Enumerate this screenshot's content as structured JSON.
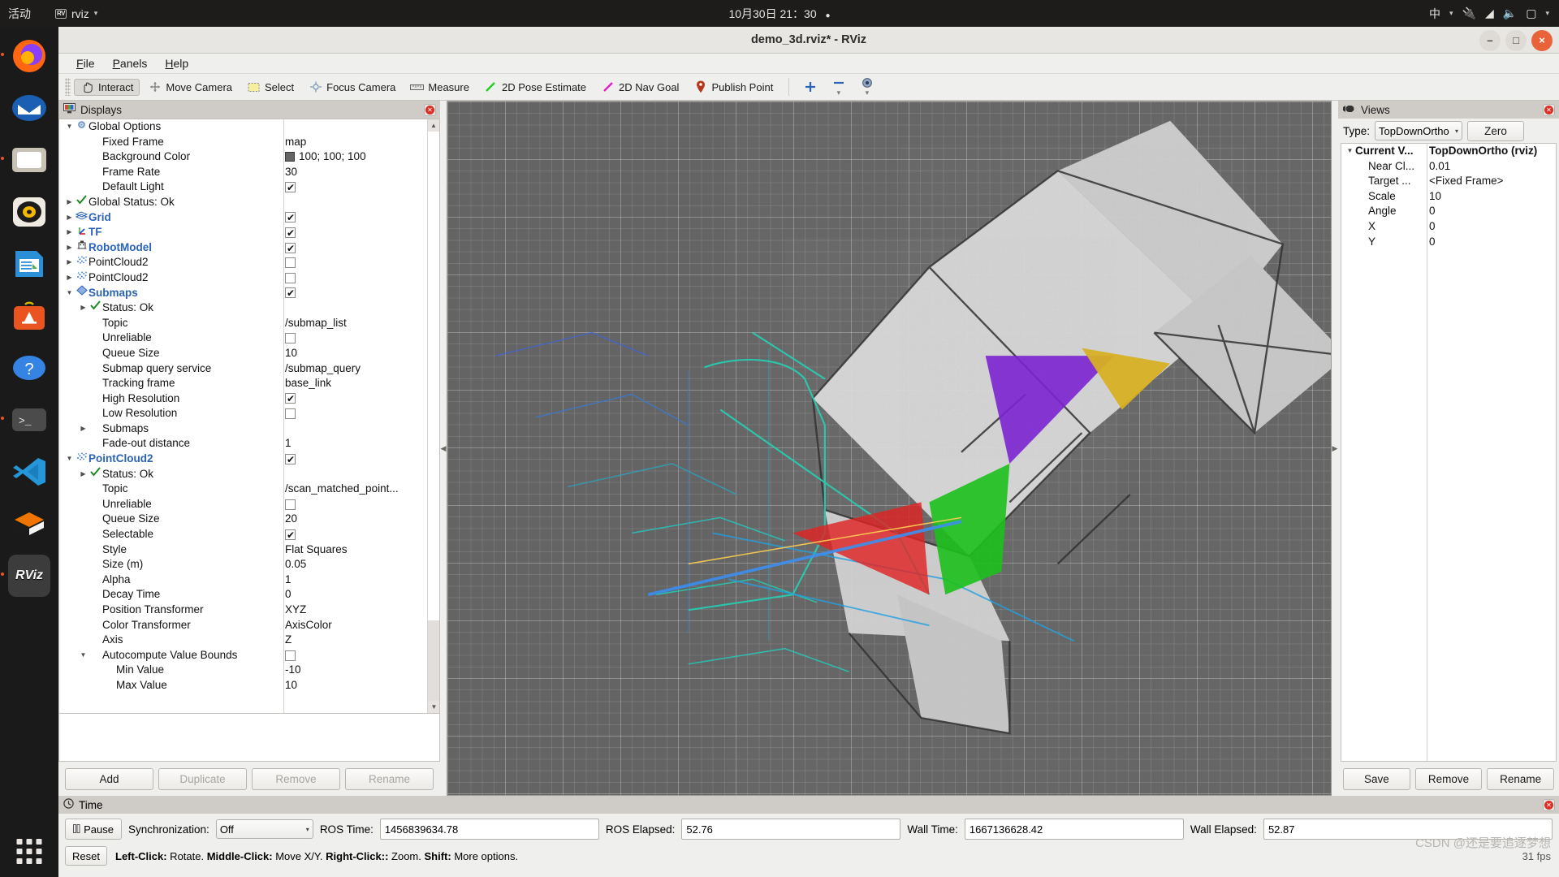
{
  "desktop": {
    "activities": "活动",
    "app_name": "rviz",
    "clock": "10月30日 21：30",
    "input_method": "中",
    "dock_items": [
      {
        "name": "firefox",
        "running": true
      },
      {
        "name": "thunderbird",
        "running": false
      },
      {
        "name": "files",
        "running": true
      },
      {
        "name": "rhythmbox",
        "running": false
      },
      {
        "name": "libreoffice-writer",
        "running": false
      },
      {
        "name": "ubuntu-software",
        "running": false
      },
      {
        "name": "help",
        "running": false
      },
      {
        "name": "terminal",
        "running": true
      },
      {
        "name": "vscode",
        "running": false
      },
      {
        "name": "cloudcompare",
        "running": false
      },
      {
        "name": "rviz",
        "running": true,
        "label": "RViz",
        "active": true
      }
    ]
  },
  "window": {
    "title": "demo_3d.rviz* - RViz",
    "minimize": "–",
    "maximize": "□",
    "close": "×"
  },
  "menubar": {
    "items": [
      {
        "first": "F",
        "rest": "ile"
      },
      {
        "first": "P",
        "rest": "anels"
      },
      {
        "first": "H",
        "rest": "elp"
      }
    ]
  },
  "toolbar": {
    "buttons": [
      {
        "label": "Interact",
        "icon": "hand-icon",
        "active": true
      },
      {
        "label": "Move Camera",
        "icon": "move-camera-icon",
        "active": false
      },
      {
        "label": "Select",
        "icon": "select-icon",
        "active": false
      },
      {
        "label": "Focus Camera",
        "icon": "focus-camera-icon",
        "active": false
      },
      {
        "label": "Measure",
        "icon": "measure-icon",
        "active": false
      },
      {
        "label": "2D Pose Estimate",
        "icon": "pose-estimate-icon",
        "active": false
      },
      {
        "label": "2D Nav Goal",
        "icon": "nav-goal-icon",
        "active": false
      },
      {
        "label": "Publish Point",
        "icon": "publish-point-icon",
        "active": false
      }
    ],
    "extras": [
      {
        "icon": "plus-icon",
        "name": "add-tool-button"
      },
      {
        "icon": "minus-icon",
        "name": "remove-tool-button"
      },
      {
        "icon": "circle-icon",
        "name": "tool-properties-button"
      }
    ]
  },
  "displays": {
    "panel_title": "Displays",
    "rows": [
      {
        "indent": 0,
        "arrow": "down",
        "icon": "gear-icon",
        "label": "Global Options",
        "value_type": "none",
        "bold": false
      },
      {
        "indent": 1,
        "arrow": "none",
        "icon": "none",
        "label": "Fixed Frame",
        "value_type": "text",
        "value": "map"
      },
      {
        "indent": 1,
        "arrow": "none",
        "icon": "none",
        "label": "Background Color",
        "value_type": "color",
        "value": "100; 100; 100",
        "color": "#646464"
      },
      {
        "indent": 1,
        "arrow": "none",
        "icon": "none",
        "label": "Frame Rate",
        "value_type": "text",
        "value": "30"
      },
      {
        "indent": 1,
        "arrow": "none",
        "icon": "none",
        "label": "Default Light",
        "value_type": "check",
        "checked": true
      },
      {
        "indent": 0,
        "arrow": "right",
        "icon": "check-icon",
        "label": "Global Status: Ok",
        "value_type": "none"
      },
      {
        "indent": 0,
        "arrow": "right",
        "icon": "grid-icon",
        "label": "Grid",
        "value_type": "check",
        "checked": true,
        "bold": true
      },
      {
        "indent": 0,
        "arrow": "right",
        "icon": "tf-icon",
        "label": "TF",
        "value_type": "check",
        "checked": true,
        "bold": true
      },
      {
        "indent": 0,
        "arrow": "right",
        "icon": "robot-icon",
        "label": "RobotModel",
        "value_type": "check",
        "checked": true,
        "bold": true
      },
      {
        "indent": 0,
        "arrow": "right",
        "icon": "pointcloud-icon",
        "label": "PointCloud2",
        "value_type": "check",
        "checked": false
      },
      {
        "indent": 0,
        "arrow": "right",
        "icon": "pointcloud-icon",
        "label": "PointCloud2",
        "value_type": "check",
        "checked": false
      },
      {
        "indent": 0,
        "arrow": "down",
        "icon": "submaps-icon",
        "label": "Submaps",
        "value_type": "check",
        "checked": true,
        "bold": true
      },
      {
        "indent": 1,
        "arrow": "right",
        "icon": "check-icon",
        "label": "Status: Ok",
        "value_type": "none"
      },
      {
        "indent": 1,
        "arrow": "none",
        "icon": "none",
        "label": "Topic",
        "value_type": "text",
        "value": "/submap_list"
      },
      {
        "indent": 1,
        "arrow": "none",
        "icon": "none",
        "label": "Unreliable",
        "value_type": "check",
        "checked": false
      },
      {
        "indent": 1,
        "arrow": "none",
        "icon": "none",
        "label": "Queue Size",
        "value_type": "text",
        "value": "10"
      },
      {
        "indent": 1,
        "arrow": "none",
        "icon": "none",
        "label": "Submap query service",
        "value_type": "text",
        "value": "/submap_query"
      },
      {
        "indent": 1,
        "arrow": "none",
        "icon": "none",
        "label": "Tracking frame",
        "value_type": "text",
        "value": "base_link"
      },
      {
        "indent": 1,
        "arrow": "none",
        "icon": "none",
        "label": "High Resolution",
        "value_type": "check",
        "checked": true
      },
      {
        "indent": 1,
        "arrow": "none",
        "icon": "none",
        "label": "Low Resolution",
        "value_type": "check",
        "checked": false
      },
      {
        "indent": 1,
        "arrow": "right",
        "icon": "none",
        "label": "Submaps",
        "value_type": "none"
      },
      {
        "indent": 1,
        "arrow": "none",
        "icon": "none",
        "label": "Fade-out distance",
        "value_type": "text",
        "value": "1"
      },
      {
        "indent": 0,
        "arrow": "down",
        "icon": "pointcloud-icon",
        "label": "PointCloud2",
        "value_type": "check",
        "checked": true,
        "bold": true
      },
      {
        "indent": 1,
        "arrow": "right",
        "icon": "check-icon",
        "label": "Status: Ok",
        "value_type": "none"
      },
      {
        "indent": 1,
        "arrow": "none",
        "icon": "none",
        "label": "Topic",
        "value_type": "text",
        "value": "/scan_matched_point..."
      },
      {
        "indent": 1,
        "arrow": "none",
        "icon": "none",
        "label": "Unreliable",
        "value_type": "check",
        "checked": false
      },
      {
        "indent": 1,
        "arrow": "none",
        "icon": "none",
        "label": "Queue Size",
        "value_type": "text",
        "value": "20"
      },
      {
        "indent": 1,
        "arrow": "none",
        "icon": "none",
        "label": "Selectable",
        "value_type": "check",
        "checked": true
      },
      {
        "indent": 1,
        "arrow": "none",
        "icon": "none",
        "label": "Style",
        "value_type": "text",
        "value": "Flat Squares"
      },
      {
        "indent": 1,
        "arrow": "none",
        "icon": "none",
        "label": "Size (m)",
        "value_type": "text",
        "value": "0.05"
      },
      {
        "indent": 1,
        "arrow": "none",
        "icon": "none",
        "label": "Alpha",
        "value_type": "text",
        "value": "1"
      },
      {
        "indent": 1,
        "arrow": "none",
        "icon": "none",
        "label": "Decay Time",
        "value_type": "text",
        "value": "0"
      },
      {
        "indent": 1,
        "arrow": "none",
        "icon": "none",
        "label": "Position Transformer",
        "value_type": "text",
        "value": "XYZ"
      },
      {
        "indent": 1,
        "arrow": "none",
        "icon": "none",
        "label": "Color Transformer",
        "value_type": "text",
        "value": "AxisColor"
      },
      {
        "indent": 1,
        "arrow": "none",
        "icon": "none",
        "label": "Axis",
        "value_type": "text",
        "value": "Z"
      },
      {
        "indent": 1,
        "arrow": "down",
        "icon": "none",
        "label": "Autocompute Value Bounds",
        "value_type": "check",
        "checked": false
      },
      {
        "indent": 2,
        "arrow": "none",
        "icon": "none",
        "label": "Min Value",
        "value_type": "text",
        "value": "-10"
      },
      {
        "indent": 2,
        "arrow": "none",
        "icon": "none",
        "label": "Max Value",
        "value_type": "text",
        "value": "10"
      }
    ],
    "buttons": [
      {
        "label": "Add",
        "enabled": true
      },
      {
        "label": "Duplicate",
        "enabled": false
      },
      {
        "label": "Remove",
        "enabled": false
      },
      {
        "label": "Rename",
        "enabled": false
      }
    ]
  },
  "views": {
    "panel_title": "Views",
    "type_label": "Type:",
    "type_value": "TopDownOrtho (",
    "zero_button": "Zero",
    "rows": [
      {
        "indent": 0,
        "arrow": "down",
        "label": "Current V...",
        "value": "TopDownOrtho (rviz)",
        "bold": true
      },
      {
        "indent": 1,
        "arrow": "none",
        "label": "Near Cl...",
        "value": "0.01"
      },
      {
        "indent": 1,
        "arrow": "none",
        "label": "Target ...",
        "value": "<Fixed Frame>"
      },
      {
        "indent": 1,
        "arrow": "none",
        "label": "Scale",
        "value": "10"
      },
      {
        "indent": 1,
        "arrow": "none",
        "label": "Angle",
        "value": "0"
      },
      {
        "indent": 1,
        "arrow": "none",
        "label": "X",
        "value": "0"
      },
      {
        "indent": 1,
        "arrow": "none",
        "label": "Y",
        "value": "0"
      }
    ],
    "buttons": [
      {
        "label": "Save"
      },
      {
        "label": "Remove"
      },
      {
        "label": "Rename"
      }
    ]
  },
  "time": {
    "panel_title": "Time",
    "pause_label": "Pause",
    "sync_label": "Synchronization:",
    "sync_value": "Off",
    "fields": [
      {
        "label": "ROS Time:",
        "value": "1456839634.78"
      },
      {
        "label": "ROS Elapsed:",
        "value": "52.76"
      },
      {
        "label": "Wall Time:",
        "value": "1667136628.42"
      },
      {
        "label": "Wall Elapsed:",
        "value": "52.87"
      }
    ],
    "reset_label": "Reset",
    "hint_parts": [
      {
        "text": "Left-Click:",
        "bold": true
      },
      {
        "text": " Rotate. ",
        "bold": false
      },
      {
        "text": "Middle-Click:",
        "bold": true
      },
      {
        "text": " Move X/Y. ",
        "bold": false
      },
      {
        "text": "Right-Click::",
        "bold": true
      },
      {
        "text": " Zoom. ",
        "bold": false
      },
      {
        "text": "Shift:",
        "bold": true
      },
      {
        "text": " More options.",
        "bold": false
      }
    ],
    "fps": "31 fps",
    "watermark": "CSDN @还是要追逐梦想"
  },
  "colors": {
    "grid_bg": "#646464",
    "accent_blue": "#2a63b8",
    "status_green": "#1a8a22",
    "ubuntu_orange": "#e95420"
  }
}
